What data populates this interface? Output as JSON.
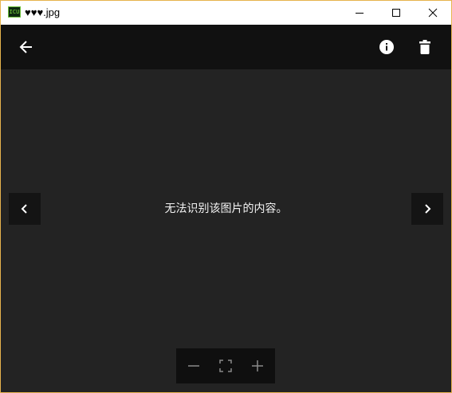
{
  "window": {
    "title": "♥♥♥.jpg",
    "app_icon_text": "ICU",
    "border_color": "#e6b34d"
  },
  "titlebar": {
    "buttons": [
      {
        "name": "minimize",
        "icon": "minimize-icon"
      },
      {
        "name": "maximize",
        "icon": "maximize-icon"
      },
      {
        "name": "close",
        "icon": "close-icon"
      }
    ]
  },
  "appbar": {
    "background": "#111111",
    "back_icon": "arrow-left-icon",
    "info_icon": "info-icon",
    "delete_icon": "trash-icon"
  },
  "viewer": {
    "background": "#232323",
    "message": "无法识别该图片的内容。",
    "prev_icon": "chevron-left-icon",
    "next_icon": "chevron-right-icon"
  },
  "zoom_toolbar": {
    "items": [
      {
        "name": "zoom-out",
        "icon": "minus-icon"
      },
      {
        "name": "fit-to-window",
        "icon": "fit-screen-icon"
      },
      {
        "name": "zoom-in",
        "icon": "plus-icon"
      }
    ]
  }
}
